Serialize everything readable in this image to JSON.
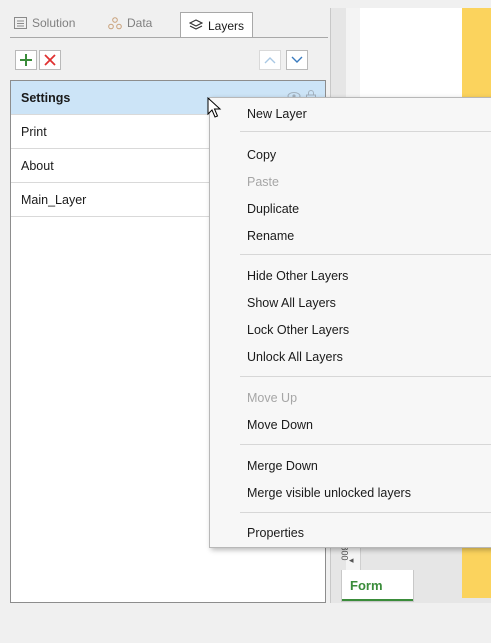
{
  "tabs": [
    {
      "label": "Solution",
      "icon": "document-icon",
      "active": false
    },
    {
      "label": "Data",
      "icon": "data-source-icon",
      "active": false
    },
    {
      "label": "Layers",
      "icon": "layers-icon",
      "active": true
    }
  ],
  "toolbar": {
    "add_icon": "plus-icon",
    "delete_icon": "close-icon",
    "move_up_icon": "chevron-up-icon",
    "move_down_icon": "chevron-down-icon"
  },
  "layers": [
    "Settings",
    "Print",
    "About",
    "Main_Layer"
  ],
  "selected_layer": "Settings",
  "context_menu": {
    "new_layer": "New Layer",
    "copy": "Copy",
    "paste": "Paste",
    "duplicate": "Duplicate",
    "rename": "Rename",
    "hide_other": "Hide Other Layers",
    "show_all": "Show All Layers",
    "lock_other": "Lock Other Layers",
    "unlock_all": "Unlock All Layers",
    "move_up": "Move Up",
    "move_down": "Move Down",
    "merge_down": "Merge Down",
    "merge_visible": "Merge visible unlocked layers",
    "properties": "Properties"
  },
  "designer": {
    "form_tab": "Form",
    "scroll_number": "800"
  },
  "colors": {
    "accent_green": "#3a8c3a",
    "delete_red": "#e03030",
    "selection": "#cce4f7",
    "canvas_yellow": "#fbd35d"
  }
}
